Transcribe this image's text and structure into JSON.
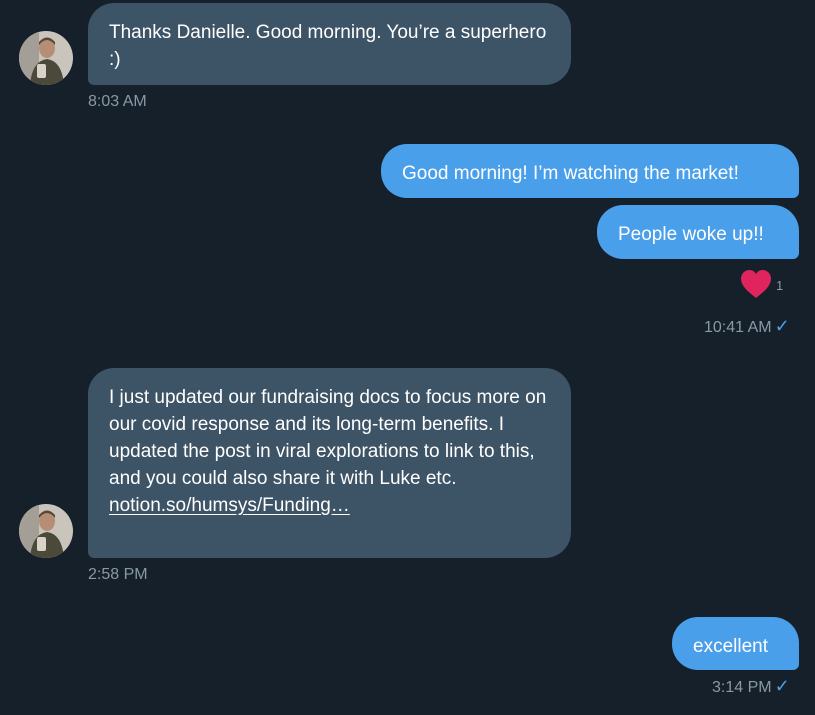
{
  "messages": [
    {
      "direction": "incoming",
      "text": "Thanks Danielle. Good morning. You’re a superhero :)",
      "time": "8:03 AM"
    },
    {
      "direction": "outgoing",
      "text": "Good morning! I’m watching the market!"
    },
    {
      "direction": "outgoing",
      "text": "People woke up!!",
      "reaction": {
        "icon": "heart-icon",
        "count": "1",
        "color": "#e0245e"
      },
      "time": "10:41 AM",
      "read_icon": "✓"
    },
    {
      "direction": "incoming",
      "text": "I just updated our fundraising docs to focus more on our covid response and its long-term benefits. I updated the post in viral explorations to link to this, and you could also share it with Luke etc.",
      "link": "notion.so/humsys/Funding…",
      "time": "2:58 PM"
    },
    {
      "direction": "outgoing",
      "text": "excellent",
      "time": "3:14 PM",
      "read_icon": "✓"
    }
  ],
  "colors": {
    "background": "#15202b",
    "incoming_bubble": "#3d5366",
    "outgoing_bubble": "#4a9fea",
    "timestamp": "#8899a6",
    "heart": "#e0245e"
  }
}
